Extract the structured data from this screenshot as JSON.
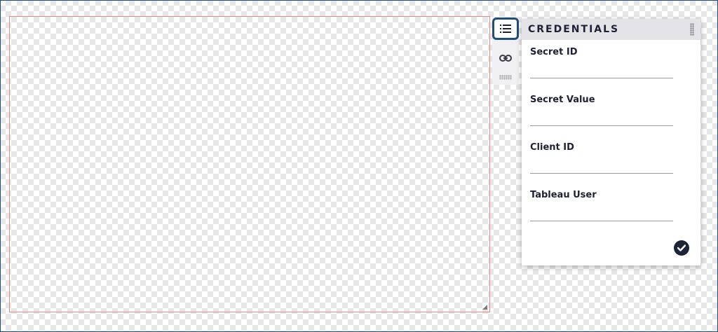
{
  "panel": {
    "title": "CREDENTIALS",
    "fields": [
      {
        "label": "Secret ID",
        "value": "",
        "placeholder": ""
      },
      {
        "label": "Secret Value",
        "value": "",
        "placeholder": ""
      },
      {
        "label": "Client ID",
        "value": "",
        "placeholder": ""
      },
      {
        "label": "Tableau User",
        "value": "",
        "placeholder": ""
      }
    ]
  },
  "toolstrip": {
    "icons": [
      "list-icon",
      "link-icon"
    ]
  },
  "icons": {
    "confirm": "check-circle-icon",
    "drag": "drag-handle-icon",
    "resize": "resize-handle-icon"
  },
  "colors": {
    "accent": "#1f4e79",
    "canvas_border": "#e88a8a",
    "confirm": "#1e2438",
    "header_bg": "#e4e4e8"
  }
}
